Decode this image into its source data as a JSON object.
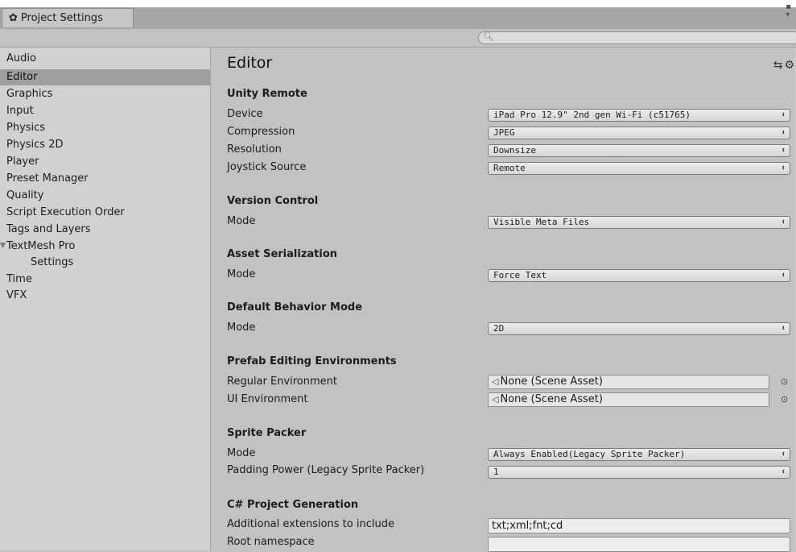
{
  "window": {
    "tab_title": "Project Settings",
    "search_placeholder": ""
  },
  "sidebar": {
    "items": [
      {
        "label": "Audio"
      },
      {
        "label": "Editor",
        "selected": true
      },
      {
        "label": "Graphics"
      },
      {
        "label": "Input"
      },
      {
        "label": "Physics"
      },
      {
        "label": "Physics 2D"
      },
      {
        "label": "Player"
      },
      {
        "label": "Preset Manager"
      },
      {
        "label": "Quality"
      },
      {
        "label": "Script Execution Order"
      },
      {
        "label": "Tags and Layers"
      },
      {
        "label": "TextMesh Pro",
        "expanded": true
      },
      {
        "label": "Settings"
      },
      {
        "label": "Time"
      },
      {
        "label": "VFX"
      }
    ]
  },
  "main": {
    "title": "Editor",
    "unity_remote": {
      "heading": "Unity Remote",
      "device_label": "Device",
      "device_value": "iPad Pro 12.9\" 2nd gen Wi-Fi (c51765)",
      "compression_label": "Compression",
      "compression_value": "JPEG",
      "resolution_label": "Resolution",
      "resolution_value": "Downsize",
      "joystick_label": "Joystick Source",
      "joystick_value": "Remote"
    },
    "version_control": {
      "heading": "Version Control",
      "mode_label": "Mode",
      "mode_value": "Visible Meta Files"
    },
    "asset_serialization": {
      "heading": "Asset Serialization",
      "mode_label": "Mode",
      "mode_value": "Force Text"
    },
    "default_behavior": {
      "heading": "Default Behavior Mode",
      "mode_label": "Mode",
      "mode_value": "2D"
    },
    "prefab_env": {
      "heading": "Prefab Editing Environments",
      "regular_label": "Regular Environment",
      "regular_value": "None (Scene Asset)",
      "ui_label": "UI Environment",
      "ui_value": "None (Scene Asset)"
    },
    "sprite_packer": {
      "heading": "Sprite Packer",
      "mode_label": "Mode",
      "mode_value": "Always Enabled(Legacy Sprite Packer)",
      "padding_label": "Padding Power (Legacy Sprite Packer)",
      "padding_value": "1"
    },
    "csharp_gen": {
      "heading": "C# Project Generation",
      "extensions_label": "Additional extensions to include",
      "extensions_value": "txt;xml;fnt;cd",
      "namespace_label": "Root namespace",
      "namespace_value": ""
    }
  }
}
